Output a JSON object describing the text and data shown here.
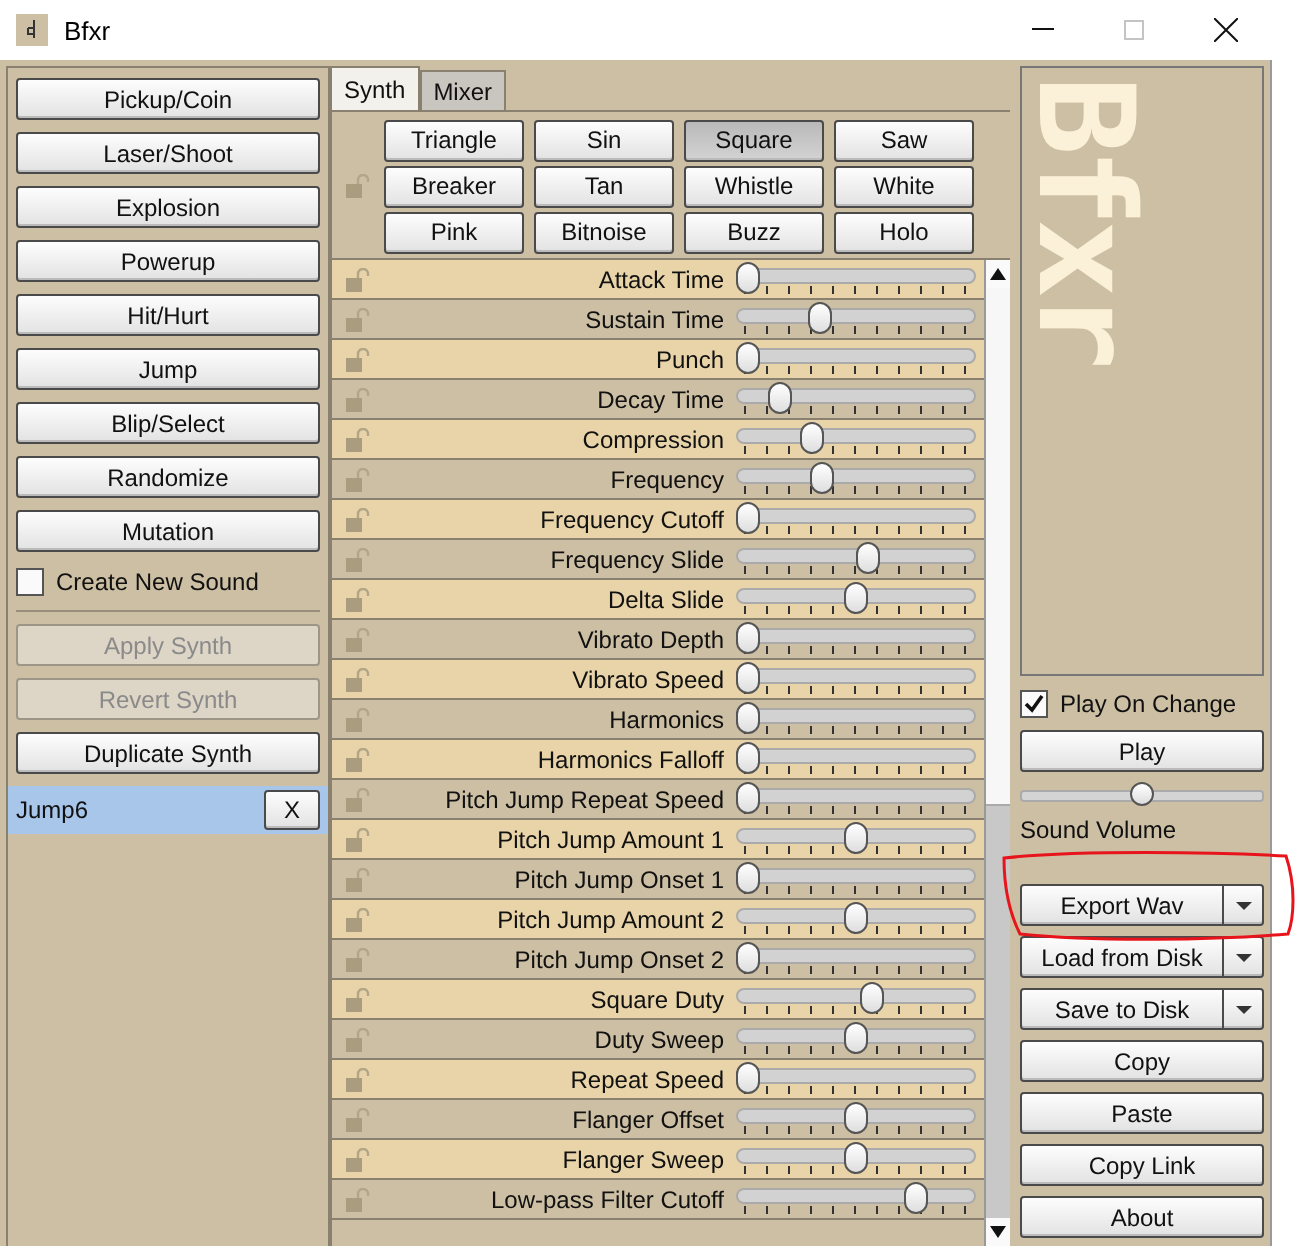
{
  "window": {
    "title": "Bfxr"
  },
  "generators": [
    "Pickup/Coin",
    "Laser/Shoot",
    "Explosion",
    "Powerup",
    "Hit/Hurt",
    "Jump",
    "Blip/Select",
    "Randomize",
    "Mutation"
  ],
  "create_new_sound": {
    "label": "Create New Sound",
    "checked": false
  },
  "synth_buttons": [
    {
      "label": "Apply Synth",
      "disabled": true
    },
    {
      "label": "Revert Synth",
      "disabled": true
    },
    {
      "label": "Duplicate Synth",
      "disabled": false
    }
  ],
  "sounds": [
    {
      "name": "Jump6",
      "selected": true,
      "delete_label": "X"
    }
  ],
  "tabs": [
    {
      "label": "Synth",
      "selected": true
    },
    {
      "label": "Mixer",
      "selected": false
    }
  ],
  "waveforms": [
    {
      "label": "Triangle",
      "selected": false
    },
    {
      "label": "Sin",
      "selected": false
    },
    {
      "label": "Square",
      "selected": true
    },
    {
      "label": "Saw",
      "selected": false
    },
    {
      "label": "Breaker",
      "selected": false
    },
    {
      "label": "Tan",
      "selected": false
    },
    {
      "label": "Whistle",
      "selected": false
    },
    {
      "label": "White",
      "selected": false
    },
    {
      "label": "Pink",
      "selected": false
    },
    {
      "label": "Bitnoise",
      "selected": false
    },
    {
      "label": "Buzz",
      "selected": false
    },
    {
      "label": "Holo",
      "selected": false
    }
  ],
  "waveform_locked": false,
  "params": [
    {
      "label": "Attack Time",
      "level": 0,
      "locked": false
    },
    {
      "label": "Sustain Time",
      "level": 0.33,
      "locked": false
    },
    {
      "label": "Punch",
      "level": 0,
      "locked": false
    },
    {
      "label": "Decay Time",
      "level": 0.15,
      "locked": false
    },
    {
      "label": "Compression",
      "level": 0.3,
      "locked": false
    },
    {
      "label": "Frequency",
      "level": 0.34,
      "locked": false
    },
    {
      "label": "Frequency Cutoff",
      "level": 0,
      "locked": false
    },
    {
      "label": "Frequency Slide",
      "level": 0.56,
      "locked": false
    },
    {
      "label": "Delta Slide",
      "level": 0.5,
      "locked": false
    },
    {
      "label": "Vibrato Depth",
      "level": 0,
      "locked": false
    },
    {
      "label": "Vibrato Speed",
      "level": 0,
      "locked": false
    },
    {
      "label": "Harmonics",
      "level": 0,
      "locked": false
    },
    {
      "label": "Harmonics Falloff",
      "level": 0,
      "locked": false
    },
    {
      "label": "Pitch Jump Repeat Speed",
      "level": 0,
      "locked": false
    },
    {
      "label": "Pitch Jump Amount 1",
      "level": 0.5,
      "locked": false
    },
    {
      "label": "Pitch Jump Onset 1",
      "level": 0,
      "locked": false
    },
    {
      "label": "Pitch Jump Amount 2",
      "level": 0.5,
      "locked": false
    },
    {
      "label": "Pitch Jump Onset 2",
      "level": 0,
      "locked": false
    },
    {
      "label": "Square Duty",
      "level": 0.57,
      "locked": false
    },
    {
      "label": "Duty Sweep",
      "level": 0.5,
      "locked": false
    },
    {
      "label": "Repeat Speed",
      "level": 0,
      "locked": false
    },
    {
      "label": "Flanger Offset",
      "level": 0.5,
      "locked": false
    },
    {
      "label": "Flanger Sweep",
      "level": 0.5,
      "locked": false
    },
    {
      "label": "Low-pass Filter Cutoff",
      "level": 0.78,
      "locked": false
    }
  ],
  "logo": {
    "text": "Bfxr"
  },
  "play_on_change": {
    "label": "Play On Change",
    "checked": true
  },
  "play_button": "Play",
  "volume": {
    "label": "Sound Volume",
    "level": 0.5
  },
  "actions": [
    {
      "label": "Export Wav",
      "kind": "split"
    },
    {
      "label": "Load from Disk",
      "kind": "split"
    },
    {
      "label": "Save to Disk",
      "kind": "split"
    },
    {
      "label": "Copy",
      "kind": "plain"
    },
    {
      "label": "Paste",
      "kind": "plain"
    },
    {
      "label": "Copy Link",
      "kind": "plain"
    },
    {
      "label": "About",
      "kind": "plain"
    }
  ]
}
